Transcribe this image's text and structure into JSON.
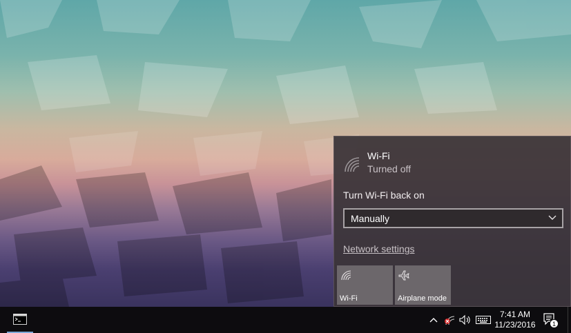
{
  "wifi_panel": {
    "network_name": "Wi-Fi",
    "status": "Turned off",
    "turn_back_label": "Turn Wi-Fi back on",
    "turn_back_value": "Manually",
    "settings_link": "Network settings"
  },
  "quick_actions": [
    {
      "label": "Wi-Fi",
      "icon": "wifi-icon"
    },
    {
      "label": "Airplane mode",
      "icon": "airplane-icon"
    }
  ],
  "taskbar": {
    "pinned_app_icon": "command-prompt-icon",
    "tray": {
      "time": "7:41 AM",
      "date": "11/23/2016",
      "notification_count": "1"
    }
  },
  "colors": {
    "flyout_bg": "#3a3438",
    "taskbar_bg": "#0d0c0f",
    "active_underline": "#7aa7d8"
  }
}
